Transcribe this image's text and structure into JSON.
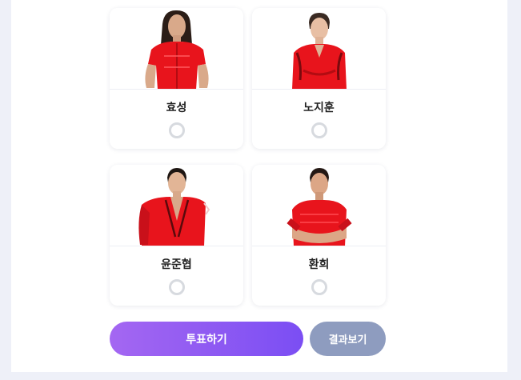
{
  "candidates": [
    {
      "name": "효성",
      "selected": false
    },
    {
      "name": "노지훈",
      "selected": false
    },
    {
      "name": "윤준협",
      "selected": false
    },
    {
      "name": "환희",
      "selected": false
    }
  ],
  "actions": {
    "vote_label": "투표하기",
    "result_label": "결과보기"
  },
  "colors": {
    "outfit_red": "#e8141c",
    "vote_gradient_start": "#a467f2",
    "vote_gradient_end": "#7b4ef3",
    "result_button": "#8e9cbf",
    "page_background": "#eef0f8"
  }
}
